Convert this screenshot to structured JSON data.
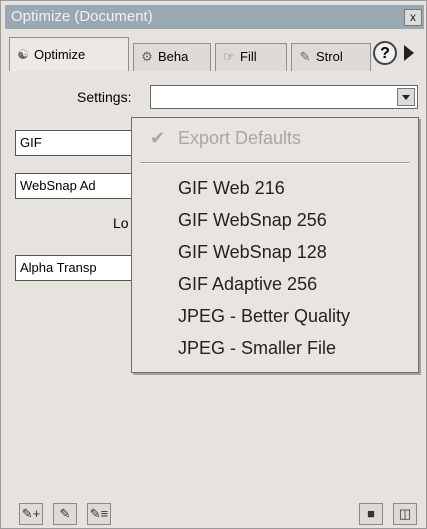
{
  "window": {
    "title": "Optimize (Document)",
    "close_label": "x"
  },
  "tabs": [
    {
      "label": "Optimize",
      "icon": "optimize-icon"
    },
    {
      "label": "Beha",
      "icon": "behaviors-icon"
    },
    {
      "label": "Fill",
      "icon": "fill-icon"
    },
    {
      "label": "Strol",
      "icon": "stroke-icon"
    }
  ],
  "help_label": "?",
  "settings": {
    "label": "Settings:",
    "value": ""
  },
  "format_field": "GIF",
  "palette_field": "WebSnap Ad",
  "lo_label": "Lo",
  "transparency_field": "Alpha Transp",
  "menu": {
    "items": [
      {
        "label": "Export Defaults",
        "checked": true,
        "disabled": true
      },
      {
        "label": "GIF Web 216"
      },
      {
        "label": "GIF WebSnap 256"
      },
      {
        "label": "GIF WebSnap 128"
      },
      {
        "label": "GIF Adaptive 256"
      },
      {
        "label": "JPEG - Better Quality"
      },
      {
        "label": "JPEG - Smaller File"
      }
    ]
  },
  "bottom_buttons": [
    {
      "icon": "add-color-icon"
    },
    {
      "icon": "edit-color-icon"
    },
    {
      "icon": "snap-color-icon"
    },
    {
      "icon": "save-icon"
    },
    {
      "icon": "trash-icon"
    }
  ]
}
